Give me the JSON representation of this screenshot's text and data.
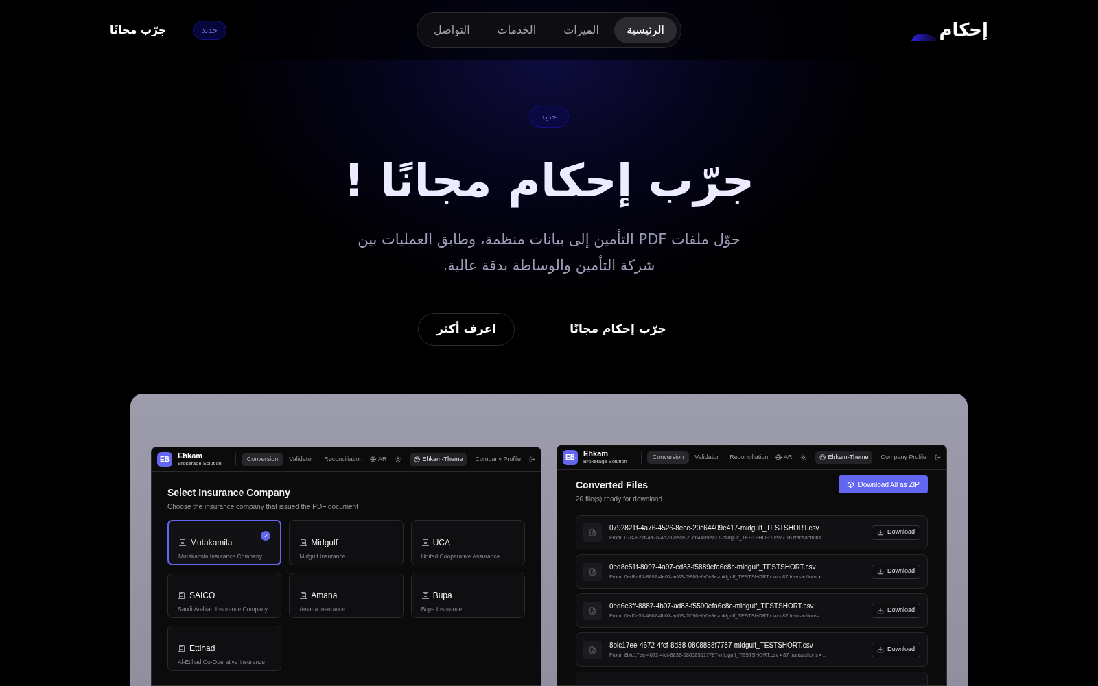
{
  "header": {
    "logo": "إحكام",
    "nav": [
      {
        "label": "الرئيسية",
        "selected": true
      },
      {
        "label": "الميزات",
        "selected": false
      },
      {
        "label": "الخدمات",
        "selected": false
      },
      {
        "label": "التواصل",
        "selected": false
      }
    ],
    "badge": "جديد",
    "cta": "جرّب مجانًا"
  },
  "hero": {
    "badge": "جديد",
    "title": "جرّب إحكام مجانًا !",
    "subtitle": "حوّل ملفات PDF التأمين إلى بيانات منظمة، وطابق العمليات بين شركة التأمين والوساطة بدقة عالية.",
    "buttons": [
      {
        "label": "جرّب إحكام مجانًا",
        "kind": "plain"
      },
      {
        "label": "اعرف أكثر",
        "kind": "outline"
      }
    ]
  },
  "previews": [
    {
      "kind": "companies",
      "app_bar": {
        "avatar": "EB",
        "brand": "Ehkam",
        "tagline": "Brokerage Solution",
        "tabs": [
          {
            "label": "Conversion",
            "selected": true
          },
          {
            "label": "Validator",
            "selected": false
          },
          {
            "label": "Reconciliation",
            "selected": false
          }
        ],
        "language": "AR",
        "theme": "Ehkam-Theme",
        "profile": "Company Profile"
      },
      "title": "Select Insurance Company",
      "subtitle": "Choose the insurance company that issued the PDF document",
      "companies": [
        {
          "name": "Mutakamila",
          "description": "Mutakamila Insurance Company",
          "selected": true
        },
        {
          "name": "Midgulf",
          "description": "Midgulf Insurance",
          "selected": false
        },
        {
          "name": "UCA",
          "description": "Unifed Cooperative Assurance",
          "selected": false
        },
        {
          "name": "SAICO",
          "description": "Saudi Aralıian Insurance Company",
          "selected": false
        },
        {
          "name": "Amana",
          "description": "Amana Insurance",
          "selected": false
        },
        {
          "name": "Bupa",
          "description": "Bupa Insurance",
          "selected": false
        },
        {
          "name": "Ettihad",
          "description": "Al-Etihad Co-Operative Insurance",
          "selected": false
        }
      ]
    },
    {
      "kind": "files",
      "app_bar": {
        "avatar": "EB",
        "brand": "Ehkam",
        "tagline": "Brokerage Solution",
        "tabs": [
          {
            "label": "Conversion",
            "selected": true
          },
          {
            "label": "Validator",
            "selected": false
          },
          {
            "label": "Reconciliation",
            "selected": false
          }
        ],
        "language": "AR",
        "theme": "Ehkam-Theme",
        "profile": "Company Profile"
      },
      "title": "Converted Files",
      "subtitle": "20 file(s) ready for download",
      "download_all": "Download All as ZIP",
      "files": [
        {
          "name": "0792821f-4a76-4526-8ece-20c64409e417-midgulf_TESTSHORT.csv",
          "source": "From: 0782821f-4a7o-4528-8ece-20c64409ea17-midgulf_TESTSHORT.csv • 16 transactions ...",
          "action": "Download"
        },
        {
          "name": "0ed8e51f-8097-4a97-ed83-f5889efa6e8c-midgulf_TESTSHORT.csv",
          "source": "From: 0ed8a8ff-8897-4e07-ad83-f5880efa0e8e-midgulf_TESTSHORT.csv • 87 transactions •...",
          "action": "Download"
        },
        {
          "name": "0ed6e3ff-8887-4b07-ad83-f5590efa6e8c-midgulf_TESTSHORT.csv",
          "source": "From: 0ed0a5ff-4867-4b07-ad03-f5690efa6e8e-midgulf_TESTSHORT.csv • 87 transactions-...",
          "action": "Download"
        },
        {
          "name": "8blc17ee-4672-4fcf-8d38-0808858f7787-midgulf_TESTSHORT.csv",
          "source": "From: 8blc17ee-4672-4fcf-8838-080585617787-midgulf_TESTSHORT.csv • 87 transactions • ...",
          "action": "Download"
        }
      ]
    }
  ]
}
